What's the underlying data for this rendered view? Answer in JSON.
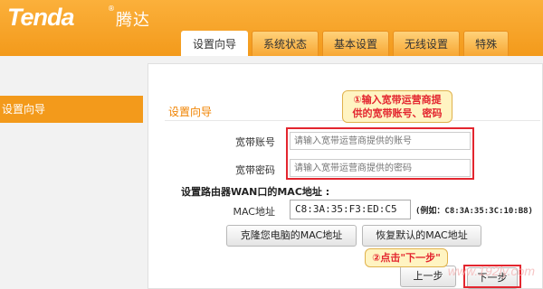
{
  "brand": {
    "logo": "Tenda",
    "registered": "®",
    "chinese_name": "腾达"
  },
  "tabs": [
    {
      "label": "设置向导",
      "active": true
    },
    {
      "label": "系统状态",
      "active": false
    },
    {
      "label": "基本设置",
      "active": false
    },
    {
      "label": "无线设置",
      "active": false
    },
    {
      "label": "特殊",
      "active": false
    }
  ],
  "sidebar": {
    "items": [
      {
        "label": "设置向导",
        "active": true
      }
    ]
  },
  "wizard": {
    "title": "设置向导",
    "account": {
      "label": "宽带账号",
      "value": "",
      "placeholder": "请输入宽带运营商提供的账号"
    },
    "password": {
      "label": "宽带密码",
      "value": "",
      "placeholder": "请输入宽带运营商提供的密码"
    },
    "mac_heading": "设置路由器WAN口的MAC地址 :",
    "mac": {
      "label": "MAC地址",
      "value": "C8:3A:35:F3:ED:C5",
      "example": "(例如：C8:3A:35:3C:10:B8)"
    },
    "clone_button": "克隆您电脑的MAC地址",
    "restore_button": "恢复默认的MAC地址",
    "prev_button": "上一步",
    "next_button": "下一步"
  },
  "annotations": {
    "callout1_line1": "①输入宽带运营商提",
    "callout1_line2": "供的宽带账号、密码",
    "callout2": "②点击\"下一步\"",
    "highlight_color": "#e3262f"
  },
  "watermark": "www.192ly.com",
  "colors": {
    "brand_orange": "#f39a1b",
    "accent_text": "#f08300"
  }
}
